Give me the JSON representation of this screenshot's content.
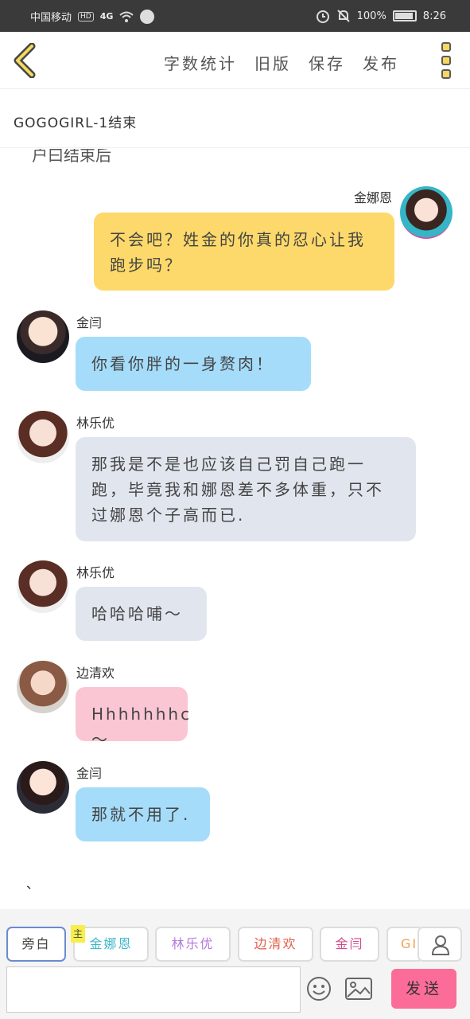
{
  "status_bar": {
    "carrier": "中国移动",
    "badge": "HD",
    "network": "4G",
    "battery": "100%",
    "time": "8:26"
  },
  "toolbar": {
    "menu": [
      "字数统计",
      "旧版",
      "保存",
      "发布"
    ]
  },
  "title": "GOGOGIRL-1结束",
  "chat": {
    "cut_text": "户曰结束后",
    "messages": [
      {
        "name": "金娜恩",
        "text": "不会吧？姓金的你真的忍心让我跑步吗？",
        "side": "right"
      },
      {
        "name": "金闫",
        "text": "你看你胖的一身赘肉！",
        "side": "left"
      },
      {
        "name": "林乐优",
        "text": "那我是不是也应该自己罚自己跑一跑，毕竟我和娜恩差不多体重，只不过娜恩个子高而已.",
        "side": "left"
      },
      {
        "name": "林乐优",
        "text": "哈哈哈哺～",
        "side": "left"
      },
      {
        "name": "边清欢",
        "text": "Hhhhhhhc～",
        "side": "left"
      },
      {
        "name": "金闫",
        "text": "那就不用了.",
        "side": "left"
      }
    ],
    "trailing": "、"
  },
  "roles": {
    "main_badge": "主",
    "chips": [
      {
        "label": "旁白",
        "color": "#444444"
      },
      {
        "label": "金娜恩",
        "color": "#3fb8c8"
      },
      {
        "label": "林乐优",
        "color": "#b47ad8"
      },
      {
        "label": "边清欢",
        "color": "#e0604a"
      },
      {
        "label": "金闫",
        "color": "#d44a8a"
      },
      {
        "label": "GIRL",
        "color": "#f0a050"
      }
    ]
  },
  "composer": {
    "input_value": "",
    "send_label": "发送"
  }
}
